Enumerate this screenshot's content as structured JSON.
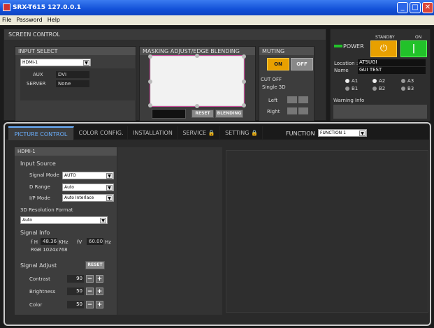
{
  "window": {
    "title": "SRX-T615 127.0.0.1"
  },
  "menu": [
    "File",
    "Password",
    "Help"
  ],
  "screen_control": {
    "label": "SCREEN CONTROL"
  },
  "input_select": {
    "header": "INPUT SELECT",
    "value": "HDMI-1",
    "aux_label": "AUX",
    "aux_value": "DVI",
    "server_label": "SERVER",
    "server_value": "None"
  },
  "masking": {
    "header": "MASKING ADJUST/EDGE BLENDING",
    "reset": "RESET",
    "blending": "BLENDING"
  },
  "muting": {
    "header": "MUTING",
    "on": "ON",
    "off": "OFF",
    "cutoff": "CUT OFF",
    "single3d": "Single 3D",
    "left": "Left",
    "right": "Right"
  },
  "power": {
    "standby": "STANDBY",
    "on": "ON",
    "label": "POWER",
    "location_label": "Location :",
    "location": "ATSUGI",
    "name_label": "Name",
    "name": "GUI TEST",
    "lamps": [
      "A1",
      "A2",
      "A3",
      "B1",
      "B2",
      "B3"
    ],
    "warning": "Warning Info"
  },
  "tabs": [
    "PICTURE CONTROL",
    "COLOR CONFIG.",
    "INSTALLATION",
    "SERVICE",
    "SETTING"
  ],
  "function": {
    "label": "FUNCTION",
    "value": "FUNCTION 1"
  },
  "picture": {
    "input_header": "HDMI-1",
    "input_source": "Input Source",
    "signal_mode_label": "Signal Mode",
    "signal_mode": "AUTO",
    "d_range_label": "D Range",
    "d_range": "Auto",
    "ip_mode_label": "I/P Mode",
    "ip_mode": "Auto Interlace",
    "res_format_label": "3D Resolution Format",
    "res_format": "Auto",
    "signal_info": "Signal Info",
    "fh_label": "f H",
    "fh": "48.36",
    "khz": "KHz",
    "fv_label": "fV",
    "fv": "60.00",
    "hz": "Hz",
    "rgb": "RGB 1024x768",
    "signal_adjust": "Signal Adjust",
    "reset": "RESET",
    "contrast_label": "Contrast",
    "contrast": "90",
    "brightness_label": "Brightness",
    "brightness": "50",
    "color_label": "Color",
    "color": "50"
  },
  "colors": {
    "accent_orange": "#e8a000",
    "power_green": "#22c22a",
    "title_blue": "#1351d8"
  }
}
